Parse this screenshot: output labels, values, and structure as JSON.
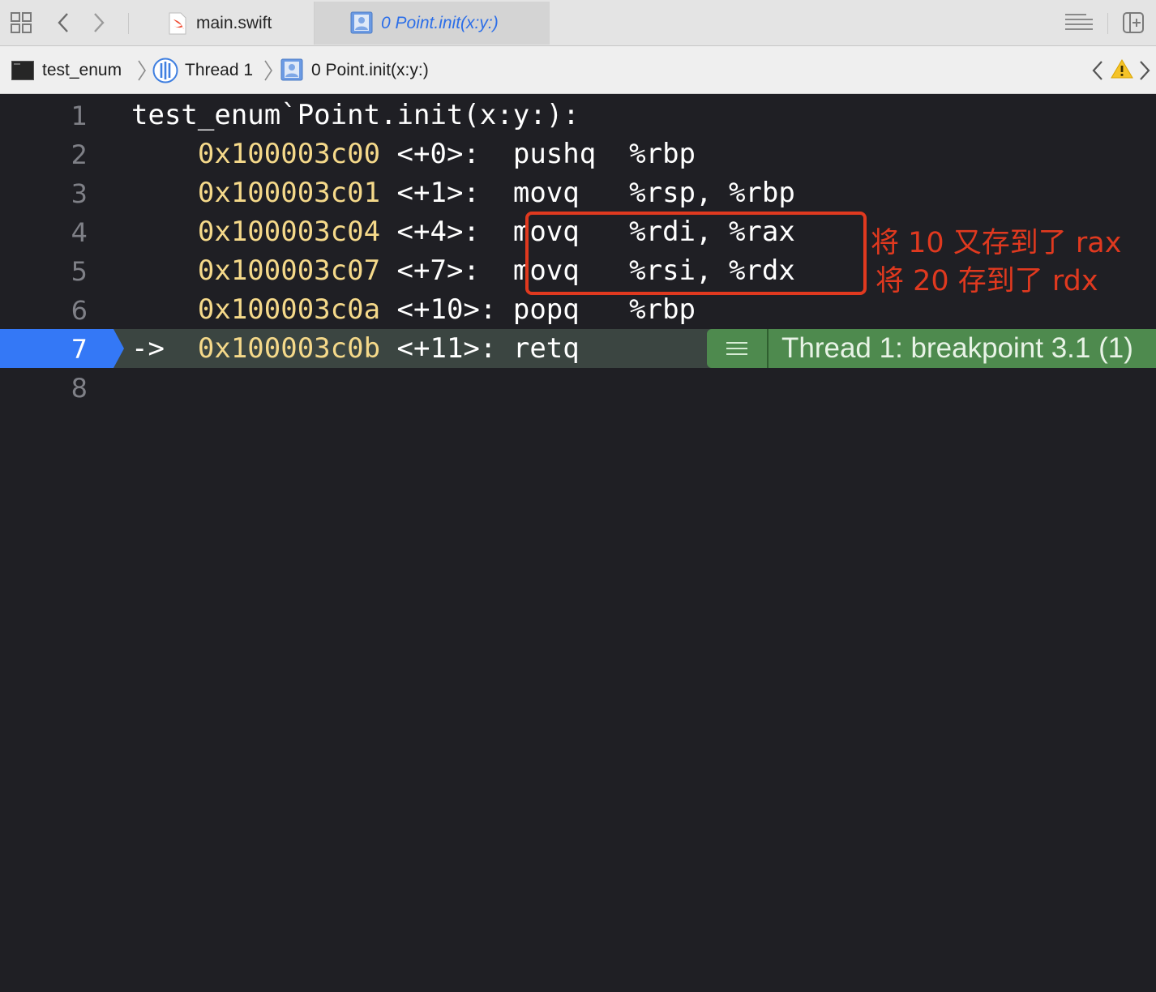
{
  "tabs": {
    "file_tab": "main.swift",
    "frame_tab": "0 Point.init(x:y:)"
  },
  "jumpbar": {
    "target": "test_enum",
    "thread": "Thread 1",
    "frame": "0 Point.init(x:y:)"
  },
  "editor": {
    "lines": [
      {
        "n": "1",
        "code": "test_enum`Point.init(x:y:):"
      },
      {
        "n": "2",
        "pad": "    ",
        "addr": "0x100003c00",
        "off": "<+0>: ",
        "inst": " pushq  %rbp"
      },
      {
        "n": "3",
        "pad": "    ",
        "addr": "0x100003c01",
        "off": "<+1>: ",
        "inst": " movq   %rsp, %rbp"
      },
      {
        "n": "4",
        "pad": "    ",
        "addr": "0x100003c04",
        "off": "<+4>: ",
        "inst": " movq   %rdi, %rax"
      },
      {
        "n": "5",
        "pad": "    ",
        "addr": "0x100003c07",
        "off": "<+7>: ",
        "inst": " movq   %rsi, %rdx"
      },
      {
        "n": "6",
        "pad": "    ",
        "addr": "0x100003c0a",
        "off": "<+10>:",
        "inst": " popq   %rbp"
      },
      {
        "n": "7",
        "pad": "->  ",
        "addr": "0x100003c0b",
        "off": "<+11>:",
        "inst": " retq"
      },
      {
        "n": "8"
      }
    ],
    "breakpoint_label": "Thread 1: breakpoint 3.1 (1)"
  },
  "annotations": {
    "note_rax": "将 10 又存到了 rax",
    "note_rdx": "将 20 存到了 rdx"
  },
  "colors": {
    "annotation": "#e0391f",
    "address": "#f5d98a",
    "pc_marker": "#3478f6",
    "breakpoint_badge": "#4e8a4e",
    "active_tab_text": "#2b6ee8"
  }
}
